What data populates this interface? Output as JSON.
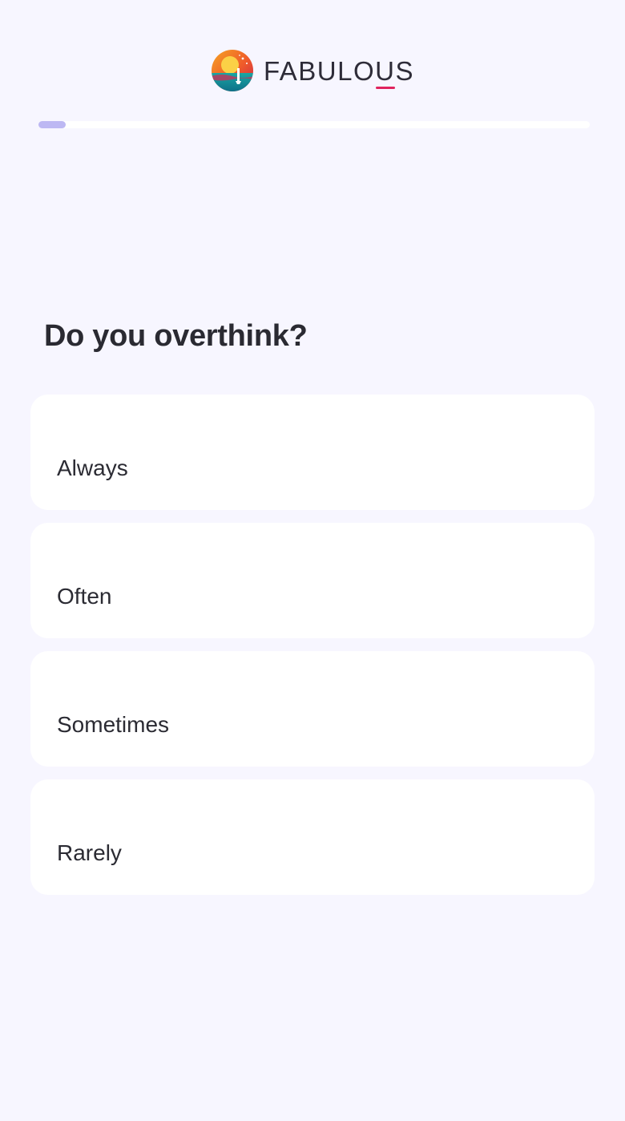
{
  "header": {
    "brand_prefix": "FABULO",
    "brand_u": "U",
    "brand_suffix": "S",
    "logo_icon": "fabulous-logo-icon"
  },
  "progress": {
    "fraction": 0.05,
    "color": "#bdb8f3"
  },
  "question": {
    "title": "Do you overthink?"
  },
  "options": [
    {
      "label": "Always"
    },
    {
      "label": "Often"
    },
    {
      "label": "Sometimes"
    },
    {
      "label": "Rarely"
    }
  ],
  "colors": {
    "background": "#f7f6ff",
    "card": "#ffffff",
    "brand_accent": "#e0245e"
  }
}
